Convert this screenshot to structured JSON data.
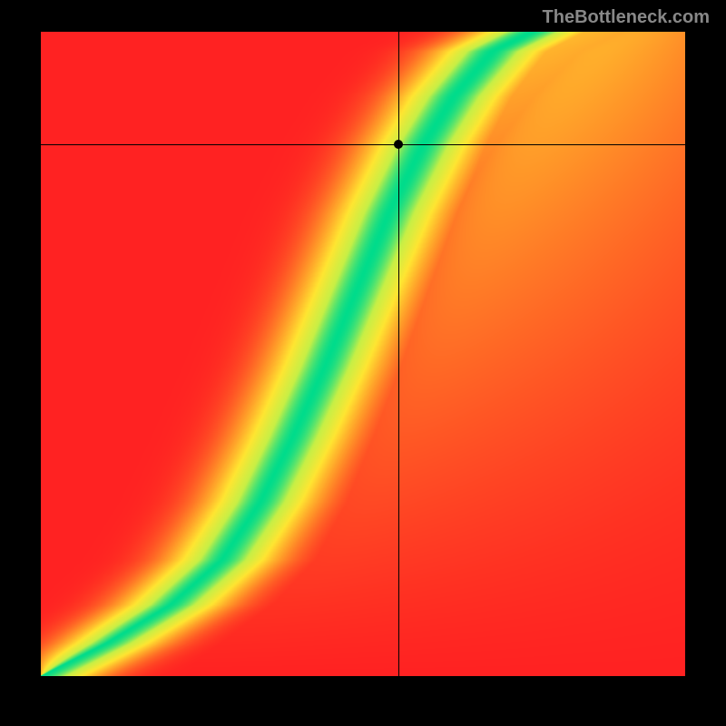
{
  "watermark": "TheBottleneck.com",
  "chart_data": {
    "type": "heatmap",
    "title": "",
    "xlabel": "",
    "ylabel": "",
    "xlim": [
      0,
      1
    ],
    "ylim": [
      0,
      1
    ],
    "canvas_size": 710,
    "offset_x": 45,
    "offset_y": 35,
    "color_stops": [
      {
        "t": 0.0,
        "r": 255,
        "g": 34,
        "b": 34
      },
      {
        "t": 0.33,
        "r": 255,
        "g": 145,
        "b": 40
      },
      {
        "t": 0.6,
        "r": 255,
        "g": 230,
        "b": 50
      },
      {
        "t": 0.82,
        "r": 200,
        "g": 240,
        "b": 70
      },
      {
        "t": 1.0,
        "r": 0,
        "g": 220,
        "b": 140
      }
    ],
    "ridge": {
      "comment": "Green optimal band follows this curve; value 1.0 on it, falling off with distance",
      "points_xy": [
        [
          0.0,
          0.0
        ],
        [
          0.1,
          0.05
        ],
        [
          0.2,
          0.11
        ],
        [
          0.28,
          0.18
        ],
        [
          0.34,
          0.27
        ],
        [
          0.39,
          0.37
        ],
        [
          0.44,
          0.48
        ],
        [
          0.49,
          0.6
        ],
        [
          0.54,
          0.72
        ],
        [
          0.59,
          0.82
        ],
        [
          0.64,
          0.9
        ],
        [
          0.7,
          0.97
        ],
        [
          0.76,
          1.0
        ]
      ],
      "band_half_width": 0.045
    },
    "corner_bias": {
      "comment": "Top-right far side tends orange/yellow not red; bottom-right red",
      "top_right_boost": 0.55,
      "bottom_left_base": 0.02
    },
    "marker": {
      "x": 0.555,
      "y": 0.825
    },
    "crosshair": {
      "x": 0.555,
      "y": 0.825
    }
  }
}
